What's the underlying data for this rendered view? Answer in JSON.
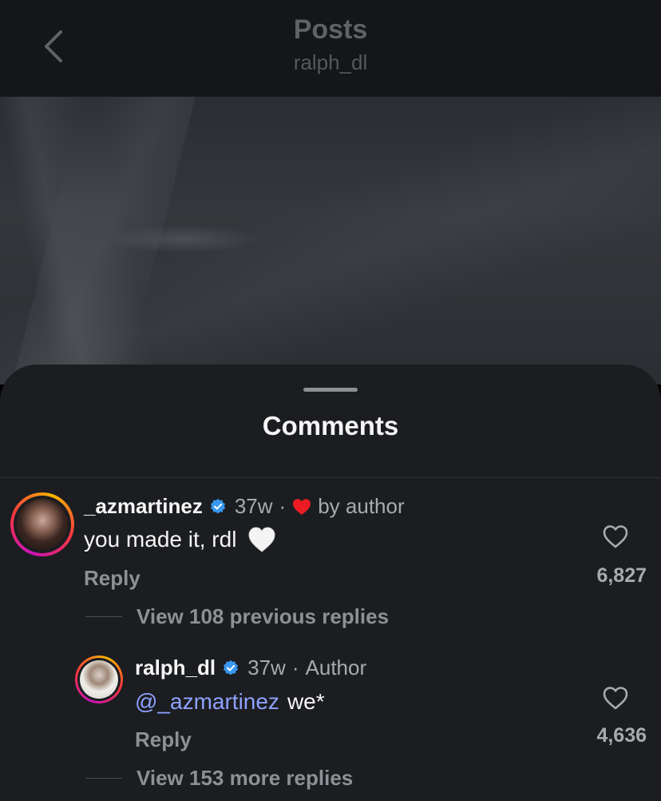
{
  "header": {
    "title": "Posts",
    "subtitle": "ralph_dl"
  },
  "sheet": {
    "title": "Comments"
  },
  "comments": [
    {
      "username": "_azmartinez",
      "verified": true,
      "time": "37w",
      "separator": "·",
      "liked_by_author_label": "by author",
      "text": "you made it, rdl",
      "emoji": "white-heart-emoji",
      "reply_label": "Reply",
      "like_count": "6,827",
      "view_replies_label": "View 108 previous replies"
    },
    {
      "username": "ralph_dl",
      "verified": true,
      "time": "37w",
      "separator": "·",
      "author_label": "Author",
      "mention": "@_azmartinez",
      "text": "we*",
      "reply_label": "Reply",
      "like_count": "4,636",
      "view_replies_label": "View 153 more replies"
    }
  ],
  "colors": {
    "background": "#1b1d20",
    "header": "#141619",
    "mention": "#8ea1ff",
    "verified": "#3897f0",
    "liked_heart": "#ed1c24",
    "muted_text": "#a8aaae"
  },
  "icons": [
    "back-chevron-icon",
    "verified-badge-icon",
    "red-heart-icon",
    "like-heart-icon"
  ]
}
